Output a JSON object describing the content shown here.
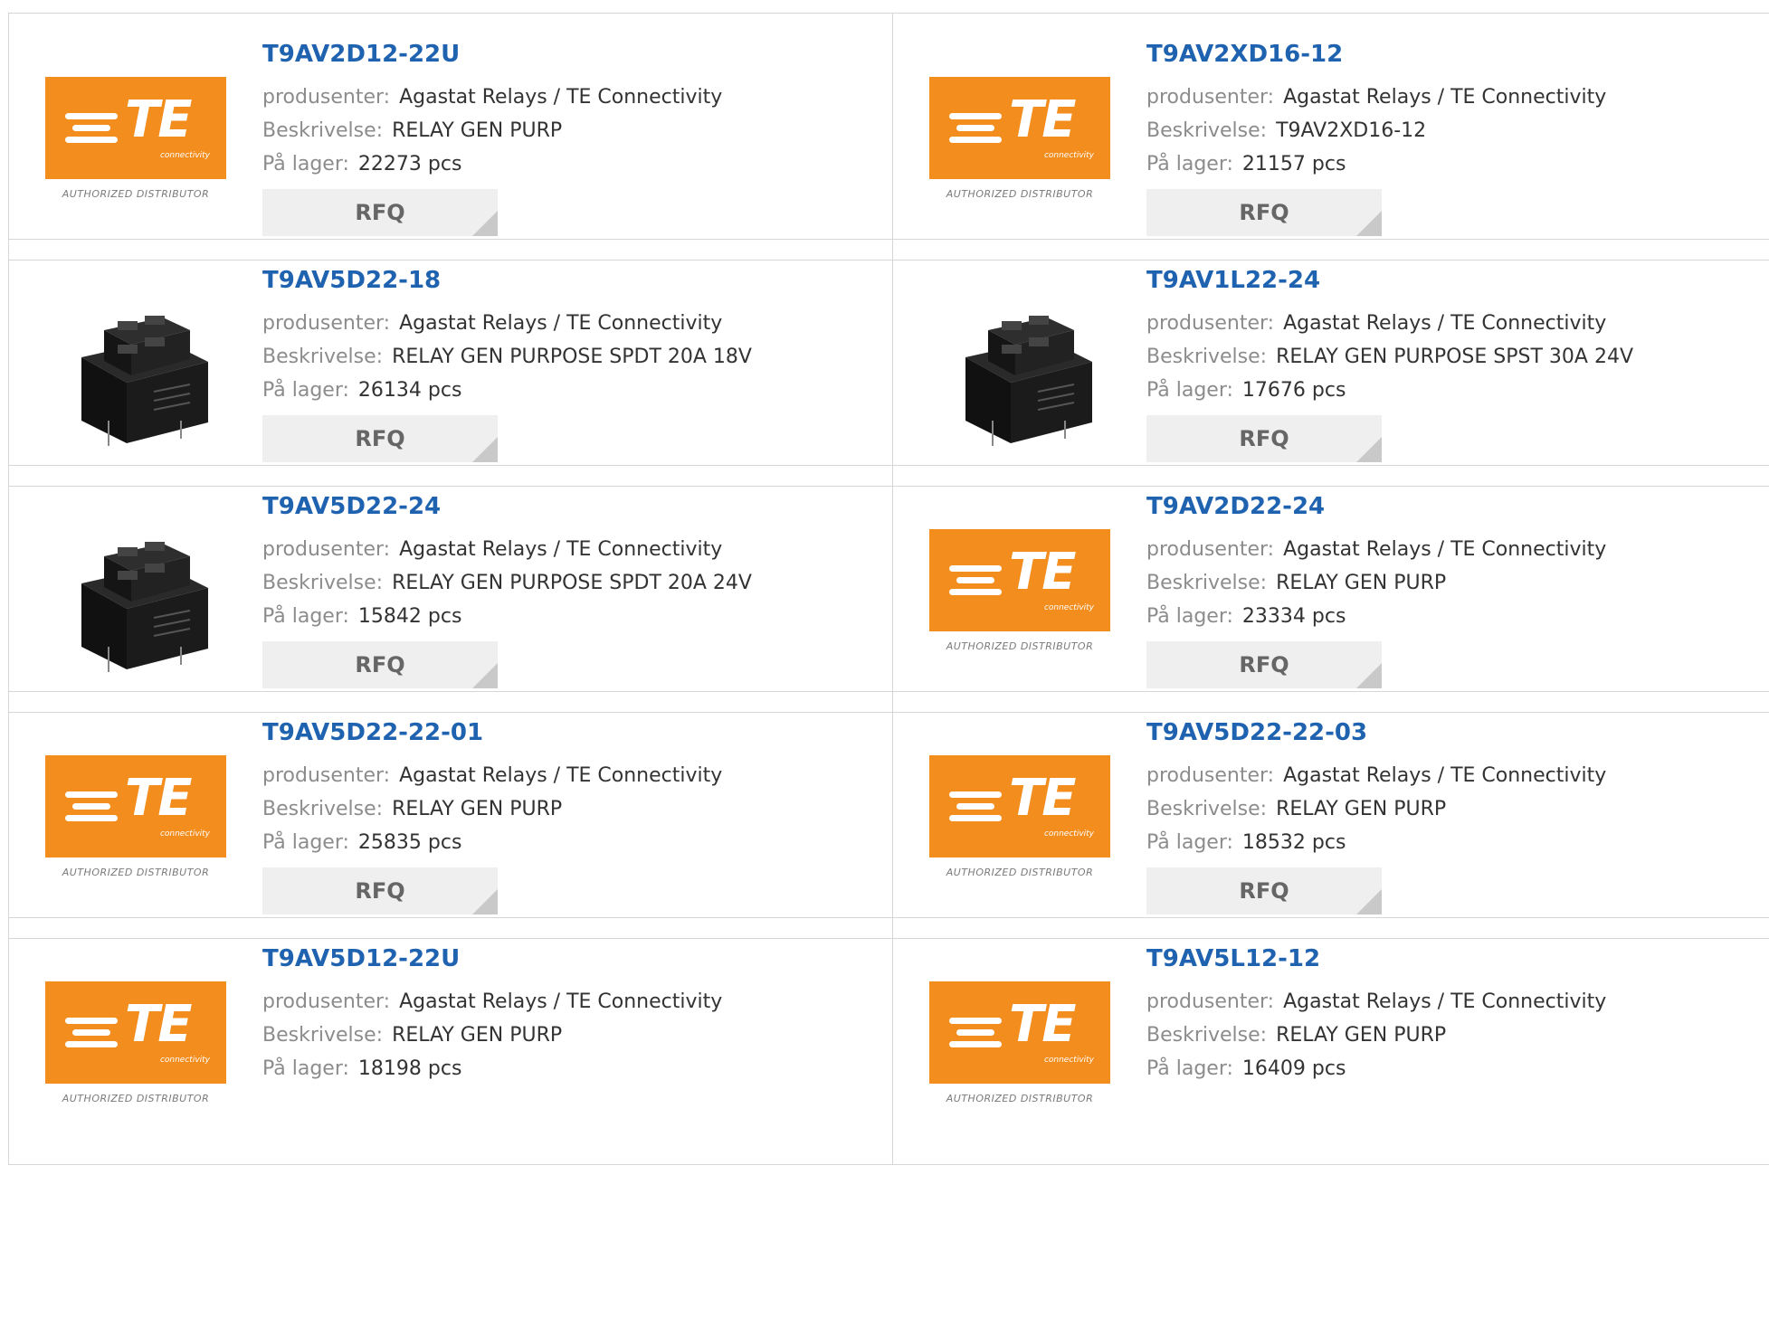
{
  "labels": {
    "manufacturer": "produsenter:",
    "description": "Beskrivelse:",
    "stock": "På lager:",
    "rfq": "RFQ"
  },
  "logo": {
    "te_word": "TE",
    "te_sub": "connectivity",
    "caption": "AUTHORIZED DISTRIBUTOR",
    "brand_color": "#f28d1e"
  },
  "link_color": "#1f63b0",
  "products": [
    {
      "part": "T9AV2D12-22U",
      "image": "te-logo",
      "manufacturer": "Agastat Relays / TE Connectivity",
      "description": "RELAY GEN PURP",
      "stock": "22273 pcs"
    },
    {
      "part": "T9AV2XD16-12",
      "image": "te-logo",
      "manufacturer": "Agastat Relays / TE Connectivity",
      "description": "T9AV2XD16-12",
      "stock": "21157 pcs"
    },
    {
      "part": "T9AV5D22-18",
      "image": "relay-photo",
      "manufacturer": "Agastat Relays / TE Connectivity",
      "description": "RELAY GEN PURPOSE SPDT 20A 18V",
      "stock": "26134 pcs"
    },
    {
      "part": "T9AV1L22-24",
      "image": "relay-photo",
      "manufacturer": "Agastat Relays / TE Connectivity",
      "description": "RELAY GEN PURPOSE SPST 30A 24V",
      "stock": "17676 pcs"
    },
    {
      "part": "T9AV5D22-24",
      "image": "relay-photo",
      "manufacturer": "Agastat Relays / TE Connectivity",
      "description": "RELAY GEN PURPOSE SPDT 20A 24V",
      "stock": "15842 pcs"
    },
    {
      "part": "T9AV2D22-24",
      "image": "te-logo",
      "manufacturer": "Agastat Relays / TE Connectivity",
      "description": "RELAY GEN PURP",
      "stock": "23334 pcs"
    },
    {
      "part": "T9AV5D22-22-01",
      "image": "te-logo",
      "manufacturer": "Agastat Relays / TE Connectivity",
      "description": "RELAY GEN PURP",
      "stock": "25835 pcs"
    },
    {
      "part": "T9AV5D22-22-03",
      "image": "te-logo",
      "manufacturer": "Agastat Relays / TE Connectivity",
      "description": "RELAY GEN PURP",
      "stock": "18532 pcs"
    },
    {
      "part": "T9AV5D12-22U",
      "image": "te-logo",
      "manufacturer": "Agastat Relays / TE Connectivity",
      "description": "RELAY GEN PURP",
      "stock": "18198 pcs"
    },
    {
      "part": "T9AV5L12-12",
      "image": "te-logo",
      "manufacturer": "Agastat Relays / TE Connectivity",
      "description": "RELAY GEN PURP",
      "stock": "16409 pcs"
    }
  ]
}
